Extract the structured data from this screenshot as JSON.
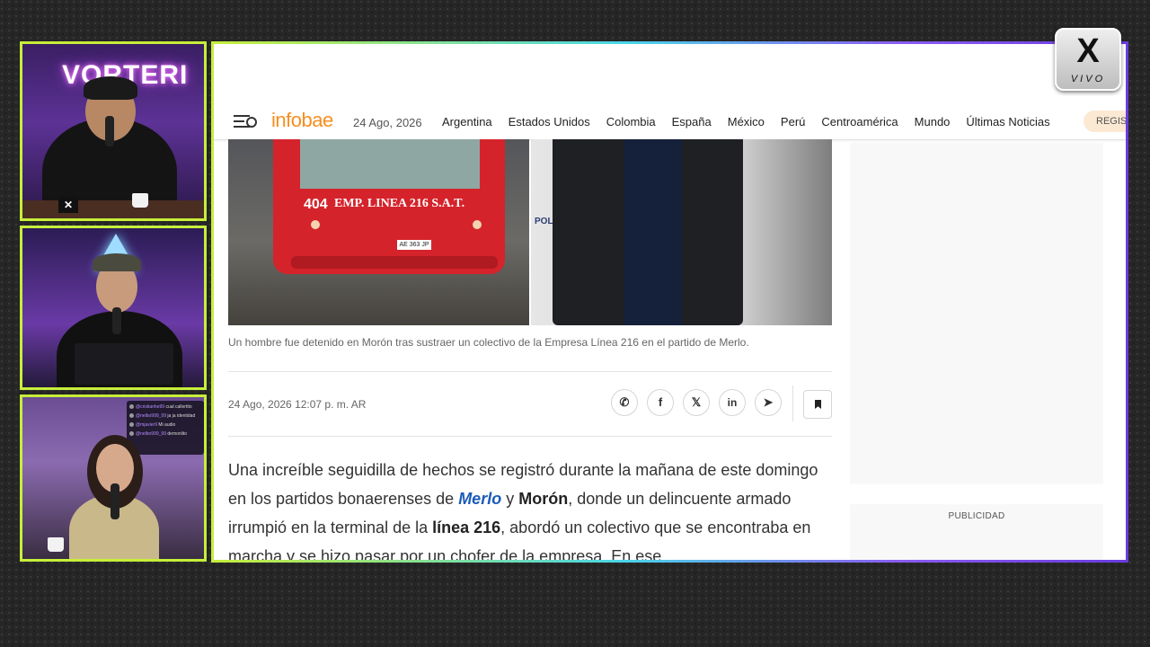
{
  "stream": {
    "cam1_sign": "VORTERI",
    "live_badge": {
      "symbol": "X",
      "label": "VIVO"
    },
    "chat": [
      {
        "user": "@cristianhe99",
        "text": "cual callertito"
      },
      {
        "user": "@nelbo999_99",
        "text": "ja ja identidad"
      },
      {
        "user": "@mjavier9",
        "text": "Mi audio"
      },
      {
        "user": "@nelbo999_99",
        "text": "demonlito"
      }
    ]
  },
  "browser": {
    "site_logo": "infobae",
    "nav_date": "24 Ago, 2026",
    "nav_links": [
      "Argentina",
      "Estados Unidos",
      "Colombia",
      "España",
      "México",
      "Perú",
      "Centroamérica",
      "Mundo",
      "Últimas Noticias"
    ],
    "register_label": "REGIS",
    "photo_left": {
      "bus_number": "404",
      "bus_sign": "EMP. LINEA 216 S.A.T.",
      "plate": "AE 363 JP"
    },
    "photo_right": {
      "wall_text": "POLI"
    },
    "caption": "Un hombre fue detenido en Morón tras sustraer un colectivo de la Empresa Línea 216 en el partido de Merlo.",
    "published": "24 Ago, 2026 12:07 p. m. AR",
    "share_icons": [
      "whatsapp-icon",
      "facebook-icon",
      "x-icon",
      "linkedin-icon",
      "telegram-icon"
    ],
    "article": {
      "p1": "Una increíble seguidilla de hechos se registró durante la mañana de este domingo en los partidos bonaerenses de ",
      "link_merlo": "Merlo",
      "y": " y ",
      "moron": "Morón",
      "p2": ", donde un delincuente armado irrumpió en la terminal de la ",
      "linea": "línea 216",
      "p3": ", abordó un colectivo que se encontraba en marcha y se hizo pasar por un chofer de la empresa. En ese"
    },
    "ad_label": "PUBLICIDAD"
  }
}
